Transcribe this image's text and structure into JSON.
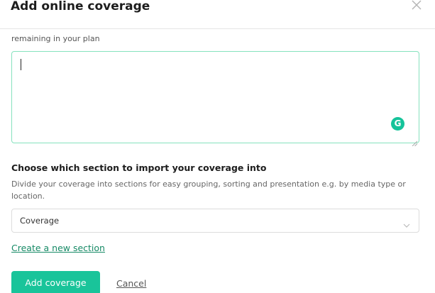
{
  "dialog": {
    "title": "Add online coverage",
    "close_icon": "close-icon"
  },
  "editor": {
    "remaining_text": "remaining in your plan",
    "value": "",
    "grammarly_icon": "grammarly-icon",
    "grammarly_letter": "G"
  },
  "section_picker": {
    "heading": "Choose which section to import your coverage into",
    "description": "Divide your coverage into sections for easy grouping, sorting and presentation e.g. by media type or location.",
    "selected": "Coverage",
    "create_link": "Create a new section"
  },
  "actions": {
    "add_label": "Add coverage",
    "cancel_label": "Cancel"
  },
  "colors": {
    "accent": "#19c49a",
    "link": "#178a66",
    "focus_border": "#86e2be"
  }
}
